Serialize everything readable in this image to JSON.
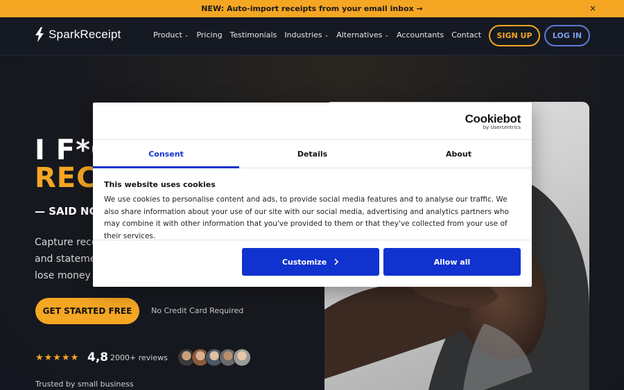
{
  "announcement": {
    "text": "NEW: Auto-import receipts from your email inbox →",
    "close": "×"
  },
  "header": {
    "brand": "SparkReceipt",
    "nav": [
      {
        "label": "Product",
        "has_dropdown": true
      },
      {
        "label": "Pricing",
        "has_dropdown": false
      },
      {
        "label": "Testimonials",
        "has_dropdown": false
      },
      {
        "label": "Industries",
        "has_dropdown": true
      },
      {
        "label": "Alternatives",
        "has_dropdown": true
      },
      {
        "label": "Accountants",
        "has_dropdown": false
      },
      {
        "label": "Contact",
        "has_dropdown": false
      }
    ],
    "signup": "SIGN UP",
    "login": "LOG IN"
  },
  "hero": {
    "headline_line1": "I F*C",
    "headline_line2": "REC",
    "said": "— SAID NO",
    "description_lines": [
      "Capture rece",
      "and stateme",
      "lose money a"
    ],
    "cta": "GET STARTED FREE",
    "no_card": "No Credit Card Required",
    "stars": "★★★★★",
    "rating": "4,8",
    "reviews": "2000+ reviews",
    "trusted": "Trusted by small business"
  },
  "cookie": {
    "brand": "Cookiebot",
    "brand_by": "by Usercentrics",
    "tabs": [
      "Consent",
      "Details",
      "About"
    ],
    "active_tab": "Consent",
    "title": "This website uses cookies",
    "text": "We use cookies to personalise content and ads, to provide social media features and to analyse our traffic. We also share information about your use of our site with our social media, advertising and analytics partners who may combine it with other information that you've provided to them or that they've collected from your use of their services.",
    "customize": "Customize",
    "allow_all": "Allow all"
  },
  "colors": {
    "accent": "#f5a623",
    "cookie_blue": "#1032cf",
    "login_blue": "#5b7bd8",
    "bg": "#14171f"
  }
}
